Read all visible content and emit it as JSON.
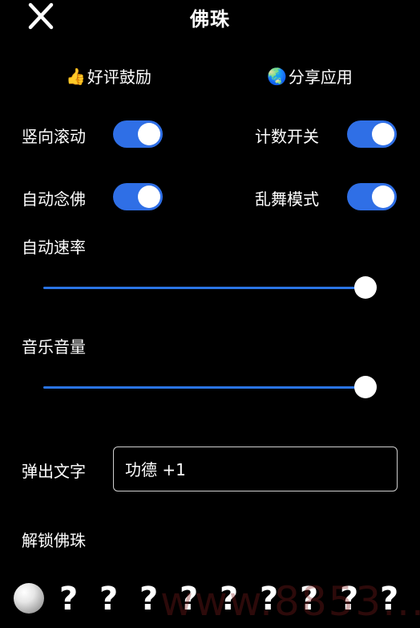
{
  "header": {
    "title": "佛珠",
    "close_icon": "close-icon"
  },
  "actions": {
    "rate": {
      "emoji": "👍",
      "label": "好评鼓励"
    },
    "share": {
      "emoji": "🌏",
      "label": "分享应用"
    }
  },
  "toggles": [
    {
      "label": "竖向滚动",
      "on": true
    },
    {
      "label": "计数开关",
      "on": true
    },
    {
      "label": "自动念佛",
      "on": true
    },
    {
      "label": "乱舞模式",
      "on": true
    }
  ],
  "sliders": [
    {
      "label": "自动速率",
      "value": 1.0
    },
    {
      "label": "音乐音量",
      "value": 1.0
    }
  ],
  "popup_text": {
    "label": "弹出文字",
    "value": "功德 +1"
  },
  "unlock": {
    "label": "解锁佛珠",
    "locked_symbol": "?",
    "locked_count": 9
  },
  "watermark": "www.8853...",
  "colors": {
    "accent": "#2f6fe6",
    "background": "#000000",
    "text": "#ffffff"
  }
}
